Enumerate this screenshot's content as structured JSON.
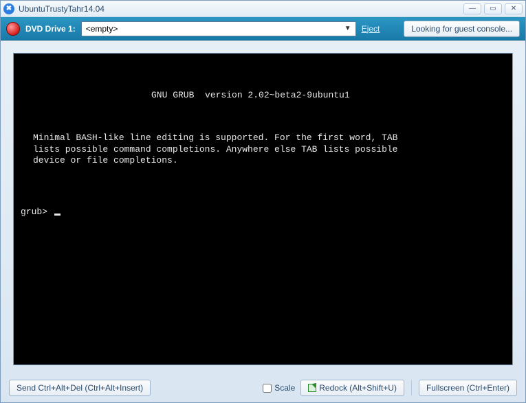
{
  "window": {
    "title": "UbuntuTrustyTahr14.04",
    "app_icon_glyph": "✖"
  },
  "toolbar": {
    "drive_label": "DVD Drive 1:",
    "drive_value": "<empty>",
    "eject": "Eject",
    "guest_button": "Looking for guest console..."
  },
  "console": {
    "headline": "GNU GRUB  version 2.02~beta2-9ubuntu1",
    "body": "Minimal BASH-like line editing is supported. For the first word, TAB\nlists possible command completions. Anywhere else TAB lists possible\ndevice or file completions.",
    "prompt": "grub> "
  },
  "bottom": {
    "send_cad": "Send Ctrl+Alt+Del (Ctrl+Alt+Insert)",
    "scale": "Scale",
    "redock": "Redock (Alt+Shift+U)",
    "fullscreen": "Fullscreen (Ctrl+Enter)"
  }
}
